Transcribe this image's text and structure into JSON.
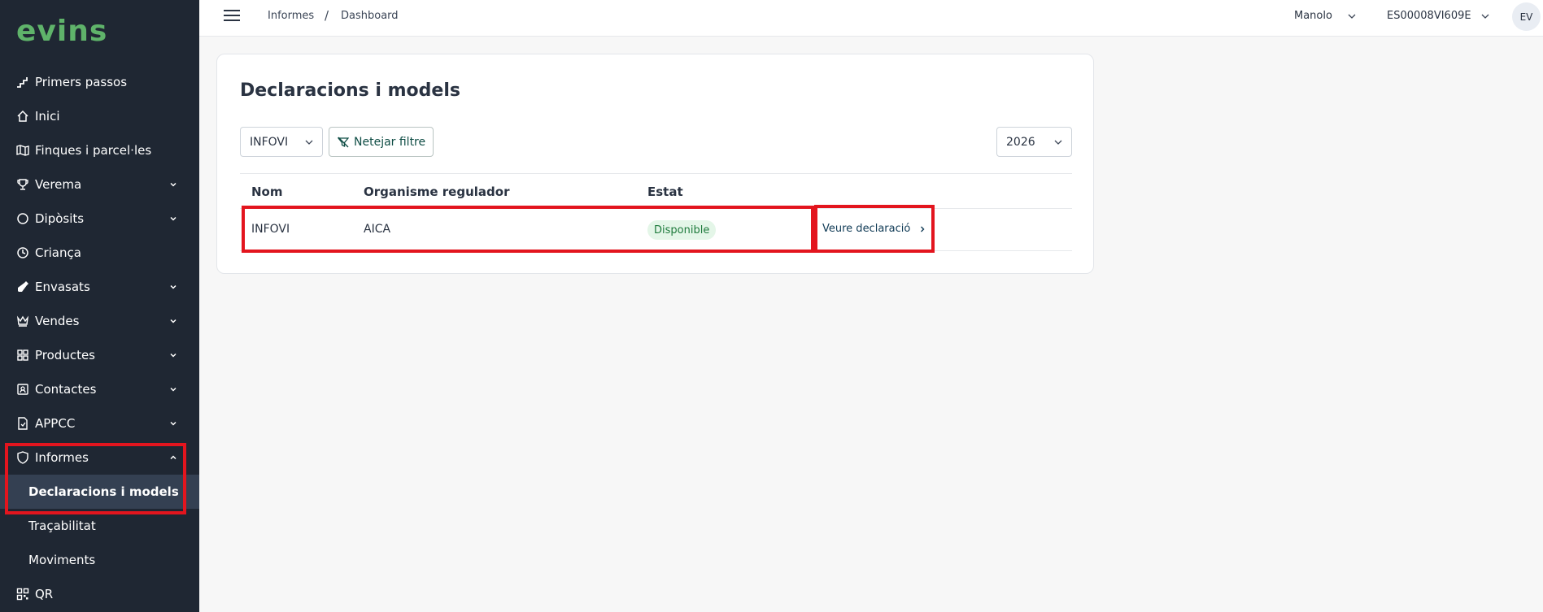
{
  "app": {
    "logo_text": "evins"
  },
  "sidebar": {
    "items": [
      {
        "label": "Primers passos",
        "icon": "stairs-icon"
      },
      {
        "label": "Inici",
        "icon": "home-icon"
      },
      {
        "label": "Finques i parcel·les",
        "icon": "map-icon"
      },
      {
        "label": "Verema",
        "icon": "trophy-icon",
        "expandable": true
      },
      {
        "label": "Dipòsits",
        "icon": "circle-icon",
        "expandable": true
      },
      {
        "label": "Criança",
        "icon": "clock-icon"
      },
      {
        "label": "Envasats",
        "icon": "bottle-icon",
        "expandable": true
      },
      {
        "label": "Vendes",
        "icon": "crown-icon",
        "expandable": true
      },
      {
        "label": "Productes",
        "icon": "grid-icon",
        "expandable": true
      },
      {
        "label": "Contactes",
        "icon": "contact-icon",
        "expandable": true
      },
      {
        "label": "APPCC",
        "icon": "document-icon",
        "expandable": true
      },
      {
        "label": "Informes",
        "icon": "shield-icon",
        "expandable": true,
        "expanded": true
      }
    ],
    "subitems": [
      {
        "label": "Declaracions i models",
        "active": true
      },
      {
        "label": "Traçabilitat"
      },
      {
        "label": "Moviments"
      }
    ],
    "last_item": {
      "label": "QR",
      "icon": "qr-icon"
    }
  },
  "topbar": {
    "breadcrumb": [
      "Informes",
      "Dashboard"
    ],
    "breadcrumb_separator": "/",
    "user_name": "Manolo",
    "company_code": "ES00008VI609E",
    "avatar_initials": "EV"
  },
  "main": {
    "title": "Declaracions i models",
    "filters": {
      "model_select_value": "INFOVI",
      "clear_filter_label": "Netejar filtre",
      "year_select_value": "2026"
    },
    "table": {
      "columns": [
        "Nom",
        "Organisme regulador",
        "Estat"
      ],
      "rows": [
        {
          "nom": "INFOVI",
          "organisme": "AICA",
          "estat": "Disponible",
          "action_label": "Veure declaració"
        }
      ]
    }
  },
  "colors": {
    "sidebar_bg": "#1f2733",
    "sidebar_active_bg": "#344052",
    "logo": "#5fb36a",
    "highlight_box": "#e3151e",
    "badge_bg": "#e4f6e8",
    "badge_text": "#1e7a3c",
    "filter_button_text": "#0f4d45"
  }
}
